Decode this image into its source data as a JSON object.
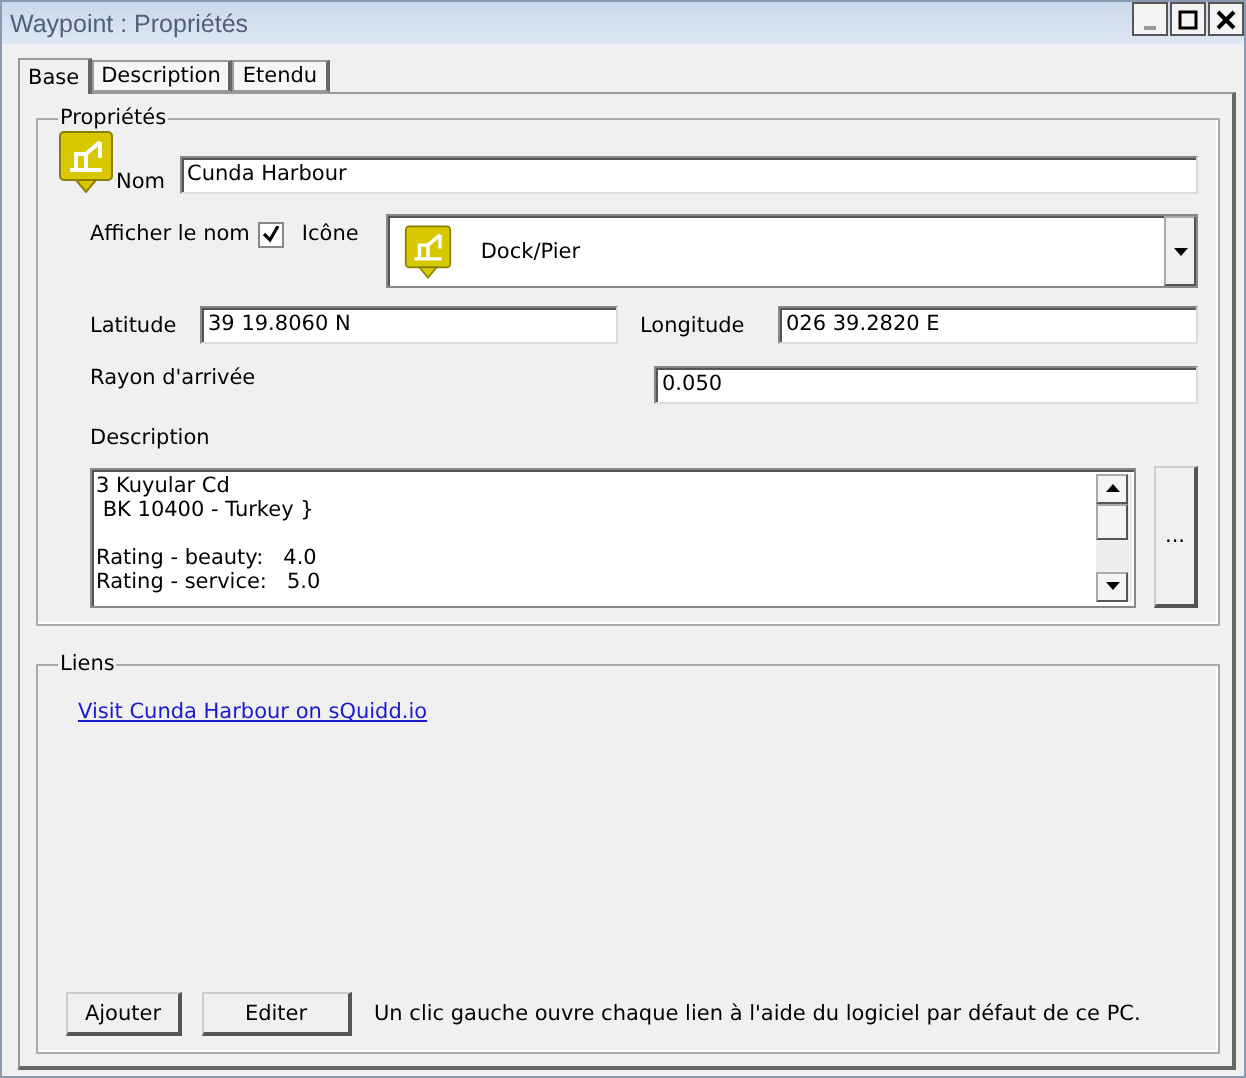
{
  "window": {
    "title": "Waypoint : Propriétés"
  },
  "tabs": [
    {
      "label": "Base",
      "selected": true
    },
    {
      "label": "Description",
      "selected": false
    },
    {
      "label": "Etendu",
      "selected": false
    }
  ],
  "properties": {
    "legend": "Propriétés",
    "name": {
      "label": "Nom",
      "value": "Cunda Harbour"
    },
    "show_name": {
      "label": "Afficher le nom",
      "checked": true
    },
    "icon": {
      "label": "Icône",
      "value": "Dock/Pier"
    },
    "latitude": {
      "label": "Latitude",
      "value": "39 19.8060 N"
    },
    "longitude": {
      "label": "Longitude",
      "value": "026 39.2820 E"
    },
    "arrival_radius": {
      "label": "Rayon d'arrivée",
      "value": "0.050"
    },
    "description": {
      "label": "Description",
      "value": "3 Kuyular Cd\n BK 10400 - Turkey }\n\nRating - beauty:   4.0\nRating - service:   5.0",
      "button": "..."
    }
  },
  "links": {
    "legend": "Liens",
    "items": [
      "Visit Cunda Harbour on sQuidd.io"
    ],
    "buttons": [
      "Ajouter",
      "Editer"
    ],
    "hint": "Un clic gauche ouvre chaque lien à l'aide du logiciel par défaut de ce PC."
  }
}
